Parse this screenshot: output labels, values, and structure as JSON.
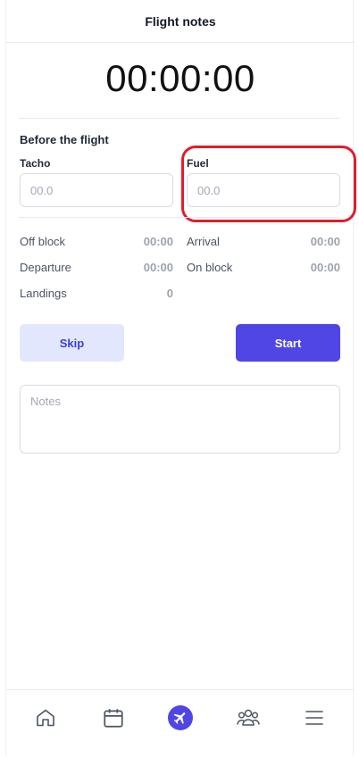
{
  "header": {
    "title": "Flight notes"
  },
  "timer": {
    "value": "00:00:00"
  },
  "before_flight": {
    "title": "Before the flight",
    "tacho": {
      "label": "Tacho",
      "placeholder": "00.0"
    },
    "fuel": {
      "label": "Fuel",
      "placeholder": "00.0"
    }
  },
  "stats": {
    "off_block": {
      "label": "Off block",
      "value": "00:00"
    },
    "arrival": {
      "label": "Arrival",
      "value": "00:00"
    },
    "departure": {
      "label": "Departure",
      "value": "00:00"
    },
    "on_block": {
      "label": "On block",
      "value": "00:00"
    },
    "landings": {
      "label": "Landings",
      "value": "0"
    }
  },
  "actions": {
    "skip_label": "Skip",
    "start_label": "Start"
  },
  "notes": {
    "placeholder": "Notes"
  },
  "colors": {
    "accent": "#4f46e5",
    "highlight": "#e11d2a",
    "skip_bg": "#e3e7fd"
  },
  "tabbar": {
    "items": [
      {
        "icon": "home-icon",
        "active": false
      },
      {
        "icon": "calendar-icon",
        "active": false
      },
      {
        "icon": "airplane-icon",
        "active": true
      },
      {
        "icon": "users-icon",
        "active": false
      },
      {
        "icon": "menu-icon",
        "active": false
      }
    ]
  }
}
